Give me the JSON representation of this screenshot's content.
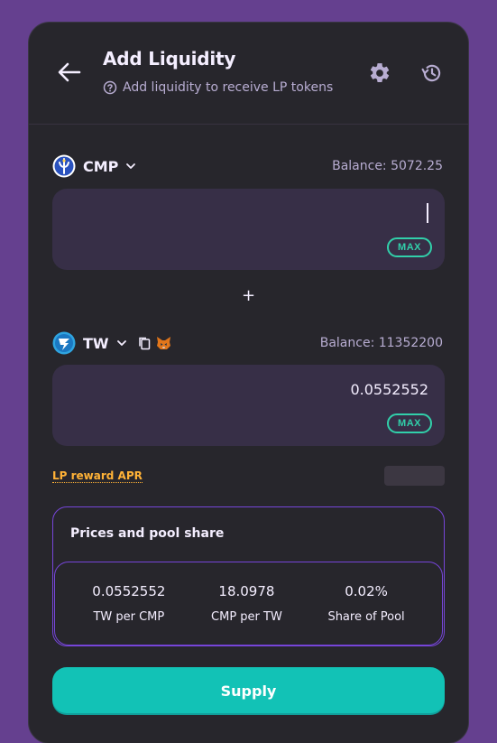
{
  "header": {
    "title": "Add Liquidity",
    "subtitle": "Add liquidity to receive LP tokens"
  },
  "token_a": {
    "symbol": "CMP",
    "balance": "Balance: 5072.25",
    "amount": "",
    "max_label": "MAX"
  },
  "plus_sign": "+",
  "token_b": {
    "symbol": "TW",
    "balance": "Balance: 11352200",
    "amount": "0.0552552",
    "max_label": "MAX"
  },
  "apr": {
    "label": "LP reward APR"
  },
  "pool": {
    "title": "Prices and pool share",
    "stats": [
      {
        "value": "0.0552552",
        "label": "TW per CMP"
      },
      {
        "value": "18.0978",
        "label": "CMP per TW"
      },
      {
        "value": "0.02%",
        "label": "Share of Pool"
      }
    ]
  },
  "supply_label": "Supply",
  "colors": {
    "background": "#65408f",
    "card": "#27262c",
    "input": "#372f47",
    "accent": "#31d0aa",
    "primary_button": "#12c2b6",
    "warning": "#ffb237",
    "border": "#7645d9"
  },
  "icons": {
    "back": "arrow-left-icon",
    "settings": "gear-icon",
    "history": "history-icon",
    "help": "question-circle-icon",
    "chevron": "chevron-down-icon",
    "copy": "copy-icon",
    "metamask": "metamask-fox-icon"
  }
}
